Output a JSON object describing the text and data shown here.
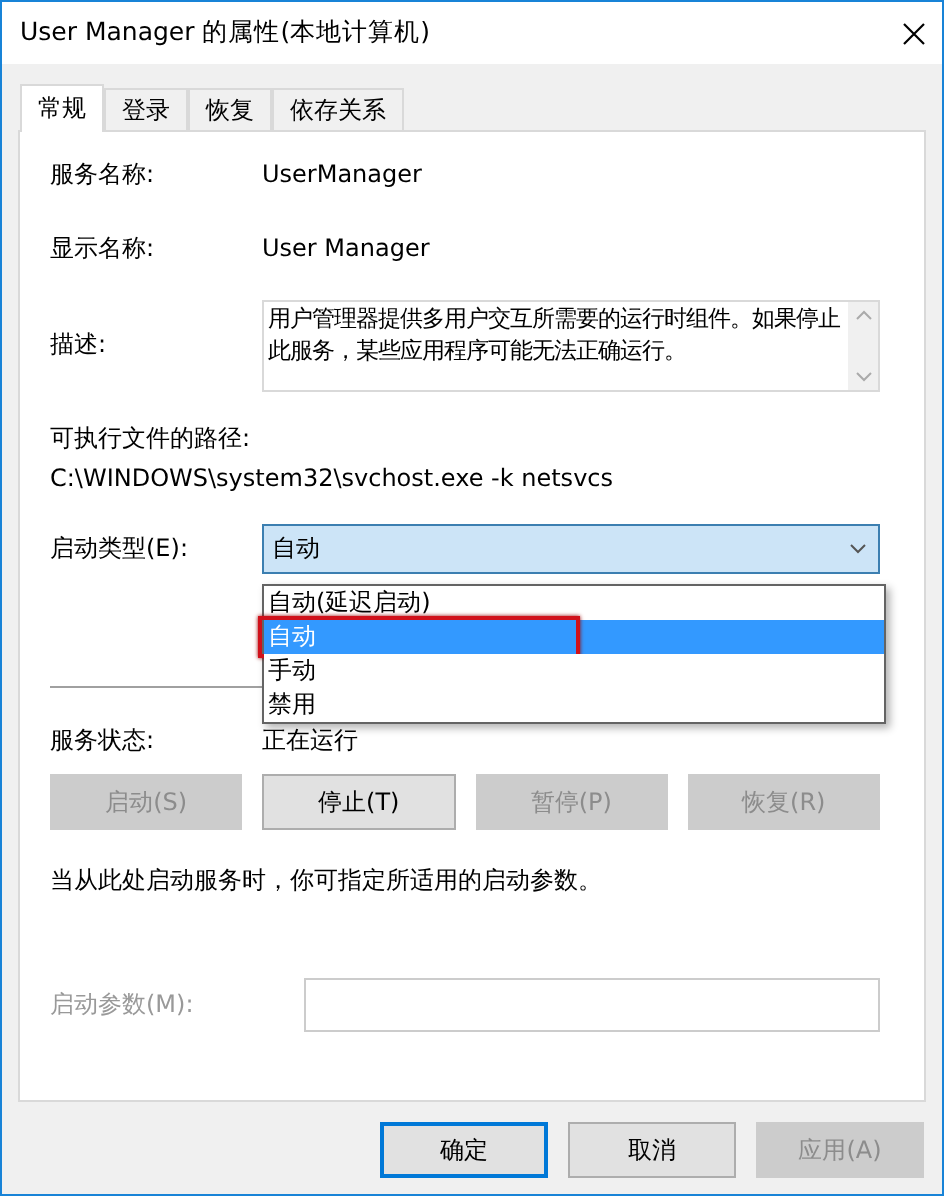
{
  "window": {
    "title": "User Manager 的属性(本地计算机)"
  },
  "tabs": [
    {
      "label": "常规",
      "selected": true
    },
    {
      "label": "登录",
      "selected": false
    },
    {
      "label": "恢复",
      "selected": false
    },
    {
      "label": "依存关系",
      "selected": false
    }
  ],
  "fields": [
    {
      "label": "服务名称:",
      "value": "UserManager"
    },
    {
      "label": "显示名称:",
      "value": "User Manager"
    }
  ],
  "description": {
    "label": "描述:",
    "text": "用户管理器提供多用户交互所需要的运行时组件。如果停止此服务，某些应用程序可能无法正确运行。"
  },
  "path": {
    "label": "可执行文件的路径:",
    "value": "C:\\WINDOWS\\system32\\svchost.exe -k netsvcs"
  },
  "startup_type": {
    "label": "启动类型(E):",
    "value": "自动",
    "expanded": true,
    "options": [
      {
        "label": "自动(延迟启动)",
        "selected": false,
        "annotated": false
      },
      {
        "label": "自动",
        "selected": true,
        "annotated": true
      },
      {
        "label": "手动",
        "selected": false,
        "annotated": false
      },
      {
        "label": "禁用",
        "selected": false,
        "annotated": false
      }
    ]
  },
  "service_status": {
    "label": "服务状态:",
    "value": "正在运行"
  },
  "service_buttons": [
    {
      "label": "启动(S)",
      "disabled": true
    },
    {
      "label": "停止(T)",
      "disabled": false
    },
    {
      "label": "暂停(P)",
      "disabled": true
    },
    {
      "label": "恢复(R)",
      "disabled": true
    }
  ],
  "hint": "当从此处启动服务时，你可指定所适用的启动参数。",
  "start_params": {
    "label": "启动参数(M):",
    "disabled": true
  },
  "buttons": [
    {
      "label": "确定",
      "default": true,
      "disabled": false
    },
    {
      "label": "取消",
      "default": false,
      "disabled": false
    },
    {
      "label": "应用(A)",
      "default": false,
      "disabled": true
    }
  ]
}
